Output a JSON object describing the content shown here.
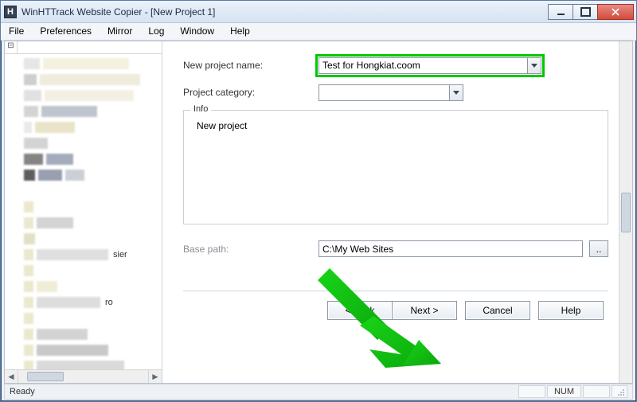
{
  "window": {
    "app_glyph": "H",
    "title": "WinHTTrack Website Copier - [New Project 1]"
  },
  "menu": {
    "file": "File",
    "preferences": "Preferences",
    "mirror": "Mirror",
    "log": "Log",
    "window": "Window",
    "help": "Help"
  },
  "tree": {
    "collapse_glyph": "⊟",
    "labels": {
      "sier": "sier",
      "ro": "ro"
    }
  },
  "form": {
    "project_name_label": "New project name:",
    "project_name_value": "Test for Hongkiat.coom",
    "project_category_label": "Project category:",
    "project_category_value": "",
    "info_legend": "Info",
    "info_text": "New project",
    "base_path_label": "Base path:",
    "base_path_value": "C:\\My Web Sites",
    "browse_label": ".."
  },
  "buttons": {
    "back": "< Back",
    "next": "Next >",
    "cancel": "Cancel",
    "help": "Help"
  },
  "status": {
    "ready": "Ready",
    "num": "NUM"
  }
}
